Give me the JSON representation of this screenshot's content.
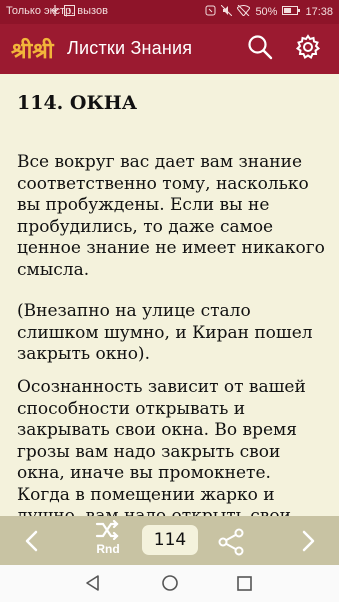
{
  "status_bar": {
    "carrier": "Только экстр. вызов",
    "battery": "50%",
    "time": "17:38"
  },
  "app_bar": {
    "logo": "श्रीश्री",
    "title": "Листки Знания"
  },
  "article": {
    "heading": "114. ОКНА",
    "paragraphs": [
      "Все вокруг вас дает вам знание соответственно тому, насколько вы пробуждены. Если вы не пробудились, то даже самое ценное знание не имеет никакого смысла.",
      "(Внезапно на улице стало слишком шумно, и Киран пошел закрыть окно).",
      "Осознанность зависит от вашей способности открывать и закрывать свои окна. Во время грозы вам надо закрыть свои окна, иначе вы промокнете. Когда в помещении жарко и душно, вам надо открыть свои"
    ]
  },
  "bottom_bar": {
    "random_label": "Rnd",
    "page_number": "114"
  },
  "colors": {
    "primary": "#9b1a30",
    "logo": "#f2b53a",
    "background": "#f4f2dc",
    "bottom_bar": "#c8c3a3"
  }
}
